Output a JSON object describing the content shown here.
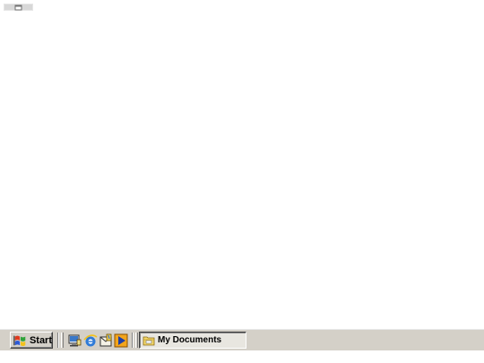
{
  "desktop": {
    "mini_tab_icon": "small-window-icon"
  },
  "taskbar": {
    "start_label": "Start",
    "start_icon": "windows-flag-icon",
    "quick_launch": [
      {
        "name": "show-desktop-icon"
      },
      {
        "name": "internet-explorer-icon"
      },
      {
        "name": "outlook-express-icon"
      },
      {
        "name": "media-player-icon"
      }
    ],
    "task_buttons": [
      {
        "label": "My Documents",
        "icon": "folder-icon"
      }
    ]
  },
  "colors": {
    "taskbar": "#d4d0c8",
    "desktop": "#ffffff"
  }
}
